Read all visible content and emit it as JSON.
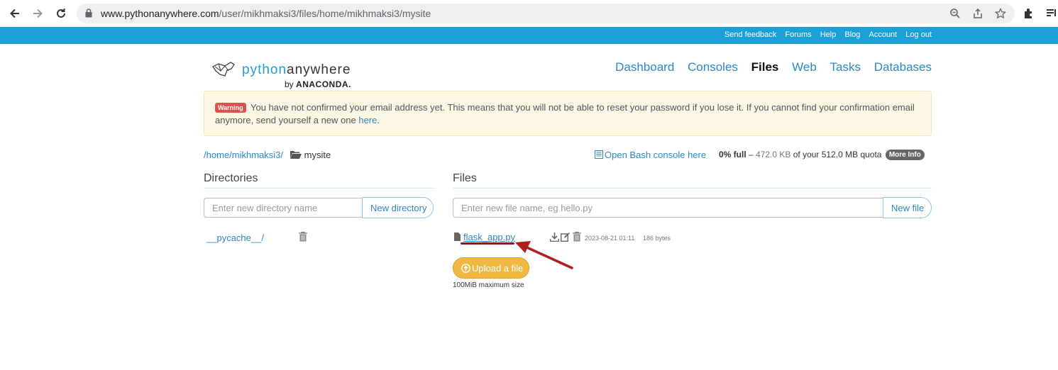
{
  "browser": {
    "url_host": "www.pythonanywhere.com",
    "url_path": "/user/mikhmaksi3/files/home/mikhmaksi3/mysite"
  },
  "toplinks": [
    "Send feedback",
    "Forums",
    "Help",
    "Blog",
    "Account",
    "Log out"
  ],
  "logo": {
    "word1": "python",
    "word2": "anywhere",
    "by": "by",
    "brand": "ANACONDA."
  },
  "nav": {
    "dashboard": "Dashboard",
    "consoles": "Consoles",
    "files": "Files",
    "web": "Web",
    "tasks": "Tasks",
    "databases": "Databases"
  },
  "warning": {
    "badge": "Warning",
    "text": "You have not confirmed your email address yet. This means that you will not be able to reset your password if you lose it. If you cannot find your confirmation email anymore, send yourself a new one ",
    "link": "here",
    "end": "."
  },
  "breadcrumb": {
    "home": "/home/",
    "user": "mikhmaksi3",
    "sep": "/",
    "current": "mysite"
  },
  "bash_link": "Open Bash console here",
  "quota": {
    "full": "0% full",
    "dash": " – ",
    "used": "472.0 KB",
    "rest": " of your 512.0 MB quota",
    "more": "More Info"
  },
  "directories": {
    "title": "Directories",
    "placeholder": "Enter new directory name",
    "button": "New directory",
    "items": [
      {
        "name": "__pycache__/"
      }
    ]
  },
  "files": {
    "title": "Files",
    "placeholder": "Enter new file name, eg hello.py",
    "button": "New file",
    "items": [
      {
        "name": "flask_app.py",
        "modified": "2023-08-21 01:11",
        "size": "186 bytes"
      }
    ],
    "upload": "Upload a file",
    "max_size": "100MiB maximum size"
  },
  "colors": {
    "brand_blue": "#1da0d8",
    "link": "#2b88c4",
    "annotation": "#b01e1e",
    "upload": "#f0b942"
  }
}
